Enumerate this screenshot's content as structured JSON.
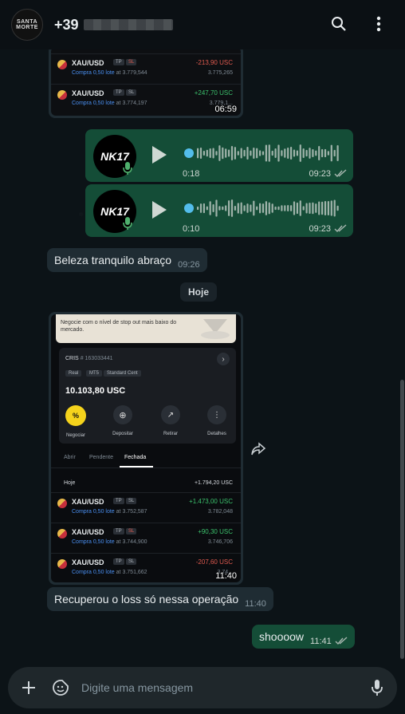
{
  "header": {
    "contact_name": "+39",
    "avatar_text": "SANTA MORTE"
  },
  "screenshot1": {
    "time": "06:59",
    "trades": [
      {
        "symbol": "XAU/USD",
        "tp": "TP",
        "sl": "SL",
        "sub_action": "Compra 0,50 lote",
        "sub_price": "at 3.779,544",
        "pl": "-213,90 USC",
        "current": "3.775,265"
      },
      {
        "symbol": "XAU/USD",
        "tp": "TP",
        "sl": "SL",
        "sub_action": "Compra 0,50 lote",
        "sub_price": "at 3.774,197",
        "pl": "+247,70 USC",
        "current": "3.779,1..."
      }
    ]
  },
  "audio_messages": [
    {
      "avatar_label": "NK17",
      "duration": "0:18",
      "time": "09:23"
    },
    {
      "avatar_label": "NK17",
      "duration": "0:10",
      "time": "09:23"
    }
  ],
  "msg1": {
    "text": "Beleza tranquilo abraço",
    "time": "09:26"
  },
  "date_chip": "Hoje",
  "screenshot2": {
    "time": "11:40",
    "banner_text": "Negocie com o nível de stop out mais baixo do mercado.",
    "account_name": "CRIS",
    "account_id": "# 163033441",
    "chips": [
      "Real",
      "MT5",
      "Standard Cent"
    ],
    "balance": "10.103,80 USC",
    "actions": [
      "Negociar",
      "Depositar",
      "Retirar",
      "Detalhes"
    ],
    "tabs": [
      "Abrir",
      "Pendente",
      "Fechada"
    ],
    "today_label": "Hoje",
    "today_total": "+1.794,20 USC",
    "trades": [
      {
        "symbol": "XAU/USD",
        "tp": "TP",
        "sl": "SL",
        "sub_action": "Compra 0,50 lote",
        "sub_price": "at 3.752,587",
        "pl": "+1.473,00 USC",
        "current": "3.782,048"
      },
      {
        "symbol": "XAU/USD",
        "tp": "TP",
        "sl": "SL",
        "sub_action": "Compra 0,50 lote",
        "sub_price": "at 3.744,900",
        "pl": "+90,30 USC",
        "current": "3.746,706"
      },
      {
        "symbol": "XAU/USD",
        "tp": "TP",
        "sl": "SL",
        "sub_action": "Compra 0,50 lote",
        "sub_price": "at 3.751,662",
        "pl": "-207,60 USC",
        "current": "3.74..."
      }
    ]
  },
  "msg2": {
    "text": "Recuperou o loss só nessa operação",
    "time": "11:40"
  },
  "msg3": {
    "text": "shoooow",
    "time": "11:41"
  },
  "input": {
    "placeholder": "Digite uma mensagem"
  },
  "colors": {
    "outgoing": "#144d37",
    "incoming": "#1f2c33",
    "background": "#0c1317",
    "accent": "#4fb06d"
  }
}
